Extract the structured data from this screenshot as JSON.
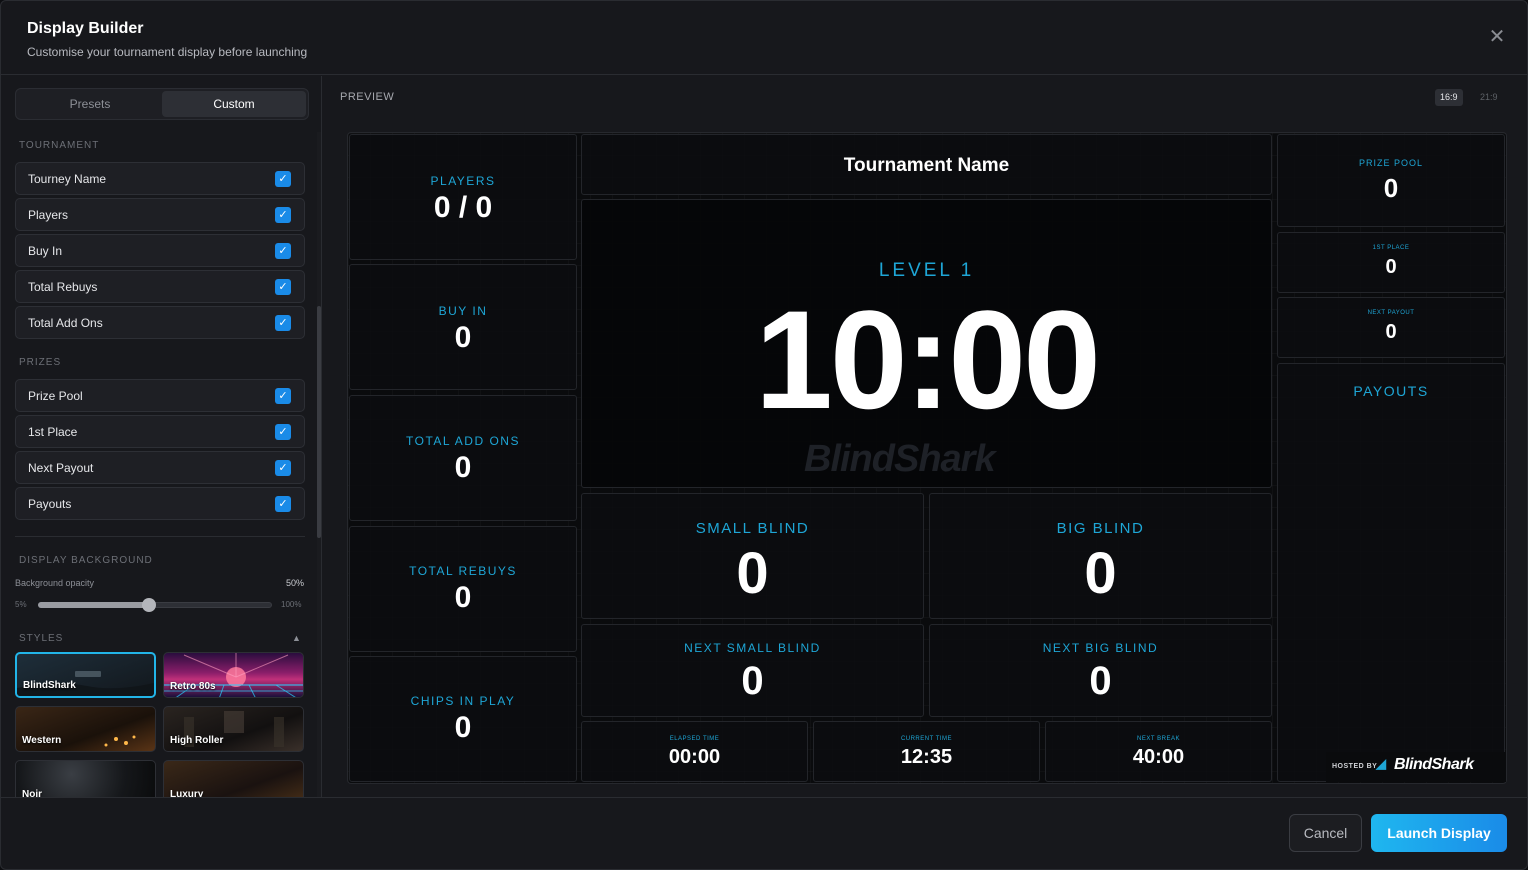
{
  "header": {
    "title": "Display Builder",
    "subtitle": "Customise your tournament display before launching"
  },
  "sidebar": {
    "tabs": [
      {
        "label": "Presets",
        "active": false
      },
      {
        "label": "Custom",
        "active": true
      }
    ],
    "sections": {
      "tournament": "TOURNAMENT",
      "prizes": "PRIZES",
      "display_background": "DISPLAY BACKGROUND",
      "styles": "STYLES"
    },
    "tournament_items": [
      {
        "label": "Tourney Name",
        "checked": true
      },
      {
        "label": "Players",
        "checked": true
      },
      {
        "label": "Buy In",
        "checked": true
      },
      {
        "label": "Total Rebuys",
        "checked": true
      },
      {
        "label": "Total Add Ons",
        "checked": true
      }
    ],
    "prize_items": [
      {
        "label": "Prize Pool",
        "checked": true
      },
      {
        "label": "1st Place",
        "checked": true
      },
      {
        "label": "Next Payout",
        "checked": true
      },
      {
        "label": "Payouts",
        "checked": true
      }
    ],
    "background": {
      "opacity_label": "Background opacity",
      "opacity_value": "50%",
      "opacity_fraction": 0.47,
      "min": "5%",
      "max": "100%"
    },
    "styles": [
      {
        "name": "BlindShark",
        "selected": true
      },
      {
        "name": "Retro 80s",
        "selected": false
      },
      {
        "name": "Western",
        "selected": false
      },
      {
        "name": "High Roller",
        "selected": false
      },
      {
        "name": "Noir",
        "selected": false
      },
      {
        "name": "Luxury",
        "selected": false
      }
    ]
  },
  "preview": {
    "label": "PREVIEW",
    "ratios": [
      {
        "label": "16:9",
        "active": true
      },
      {
        "label": "21:9",
        "active": false
      }
    ],
    "tournament_name": "Tournament Name",
    "players": {
      "label": "PLAYERS",
      "value": "0 / 0"
    },
    "buy_in": {
      "label": "BUY IN",
      "value": "0"
    },
    "total_add_ons": {
      "label": "TOTAL ADD ONS",
      "value": "0"
    },
    "total_rebuys": {
      "label": "TOTAL REBUYS",
      "value": "0"
    },
    "chips_in_play": {
      "label": "CHIPS IN PLAY",
      "value": "0"
    },
    "level": "LEVEL 1",
    "clock": "10:00",
    "watermark": "BlindShark",
    "small_blind": {
      "label": "SMALL BLIND",
      "value": "0"
    },
    "big_blind": {
      "label": "BIG BLIND",
      "value": "0"
    },
    "next_small_blind": {
      "label": "NEXT SMALL BLIND",
      "value": "0"
    },
    "next_big_blind": {
      "label": "NEXT BIG BLIND",
      "value": "0"
    },
    "elapsed_time": {
      "label": "ELAPSED TIME",
      "value": "00:00"
    },
    "current_time": {
      "label": "CURRENT TIME",
      "value": "12:35"
    },
    "next_break": {
      "label": "NEXT BREAK",
      "value": "40:00"
    },
    "prize_pool": {
      "label": "PRIZE POOL",
      "value": "0"
    },
    "first_place": {
      "label": "1ST PLACE",
      "value": "0"
    },
    "next_payout": {
      "label": "NEXT PAYOUT",
      "value": "0"
    },
    "payouts": {
      "label": "PAYOUTS"
    },
    "hosted_by": "HOSTED BY",
    "brand": "BlindShark"
  },
  "footer": {
    "cancel_label": "Cancel",
    "launch_label": "Launch Display"
  },
  "colors": {
    "accent": "#1ea6d6",
    "checkbox": "#1a8be8",
    "launch_start": "#1fb7ef",
    "launch_end": "#1a8be8"
  }
}
